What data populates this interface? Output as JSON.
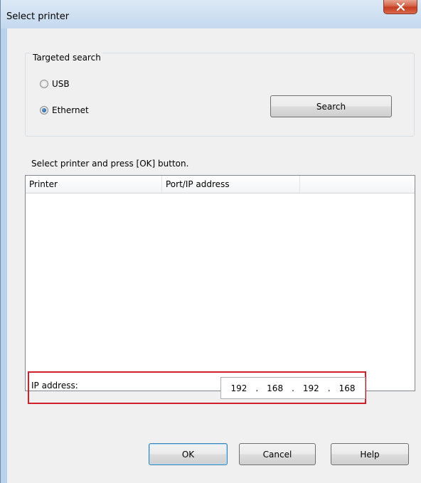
{
  "window": {
    "title": "Select printer"
  },
  "targeted_search": {
    "legend": "Targeted search",
    "options": [
      {
        "label": "USB",
        "checked": false
      },
      {
        "label": "Ethernet",
        "checked": true
      }
    ],
    "search_label": "Search"
  },
  "instruction": "Select printer and press [OK] button.",
  "list": {
    "columns": [
      "Printer",
      "Port/IP address",
      ""
    ],
    "rows": []
  },
  "ip": {
    "label": "IP address:",
    "octets": [
      "192",
      "168",
      "192",
      "168"
    ],
    "separator": "."
  },
  "buttons": {
    "ok": "OK",
    "cancel": "Cancel",
    "help": "Help"
  },
  "colors": {
    "highlight_border": "#d0202b",
    "client_bg": "#f0f0f0"
  }
}
